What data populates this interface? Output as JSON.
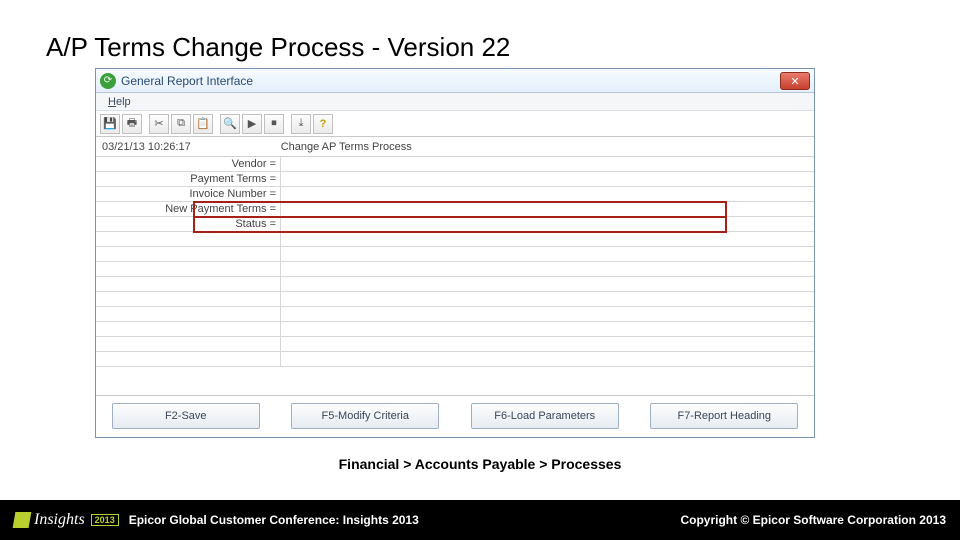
{
  "slide": {
    "title": "A/P Terms Change Process  - Version 22",
    "breadcrumb": "Financial > Accounts Payable > Processes"
  },
  "window": {
    "title": "General Report Interface",
    "menu": {
      "help": "Help"
    },
    "status": {
      "datetime": "03/21/13 10:26:17",
      "process": "Change AP Terms Process"
    },
    "fields": [
      {
        "label": "Vendor ="
      },
      {
        "label": "Payment Terms ="
      },
      {
        "label": "Invoice Number ="
      },
      {
        "label": "New Payment Terms ="
      },
      {
        "label": "Status ="
      }
    ],
    "buttons": {
      "save": "F2-Save",
      "modify": "F5-Modify Criteria",
      "load": "F6-Load Parameters",
      "report": "F7-Report Heading"
    }
  },
  "footer": {
    "logo_text": "Insights",
    "logo_year": "2013",
    "conference": "Epicor Global Customer Conference: Insights 2013",
    "copyright": "Copyright © Epicor Software Corporation 2013"
  }
}
